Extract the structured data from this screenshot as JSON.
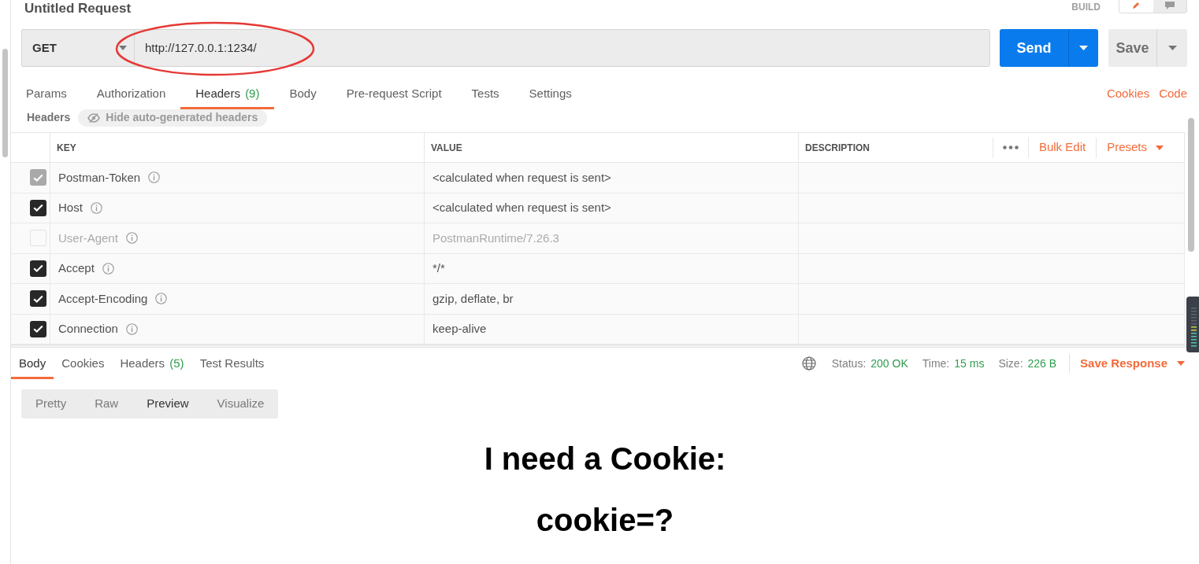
{
  "request": {
    "title": "Untitled Request",
    "mode_label": "BUILD",
    "modes": [
      {
        "kind": "build",
        "selected": true
      },
      {
        "kind": "browse",
        "selected": false
      }
    ]
  },
  "url_bar": {
    "method": "GET",
    "url": "http://127.0.0.1:1234/",
    "circled": true
  },
  "send_button": "Send",
  "save_button": "Save",
  "request_tabs": [
    {
      "label": "Params",
      "selected": false
    },
    {
      "label": "Authorization",
      "selected": false
    },
    {
      "label": "Headers",
      "count": "(9)",
      "selected": true
    },
    {
      "label": "Body",
      "selected": false
    },
    {
      "label": "Pre-request Script",
      "selected": false
    },
    {
      "label": "Tests",
      "selected": false
    },
    {
      "label": "Settings",
      "selected": false
    }
  ],
  "request_links": [
    "Cookies",
    "Code"
  ],
  "headers_bar": {
    "title": "Headers",
    "toggle": "Hide auto-generated headers"
  },
  "headers_table": {
    "columns": [
      "KEY",
      "VALUE",
      "DESCRIPTION"
    ],
    "actions": [
      {
        "label": "Bulk Edit",
        "kind": "button"
      },
      {
        "label": "Presets",
        "kind": "dropdown"
      }
    ],
    "rows": [
      {
        "kind": "locked",
        "key": "Postman-Token",
        "value": "<calculated when request is sent>",
        "checked": true
      },
      {
        "kind": "toggle",
        "key": "Host",
        "value": "<calculated when request is sent>",
        "checked": true
      },
      {
        "kind": "toggle",
        "key": "User-Agent",
        "value": "PostmanRuntime/7.26.3",
        "checked": false
      },
      {
        "kind": "toggle",
        "key": "Accept",
        "value": "*/*",
        "checked": true
      },
      {
        "kind": "toggle",
        "key": "Accept-Encoding",
        "value": "gzip, deflate, br",
        "checked": true
      },
      {
        "kind": "toggle",
        "key": "Connection",
        "value": "keep-alive",
        "checked": true
      }
    ]
  },
  "response": {
    "tabs": [
      {
        "label": "Body",
        "selected": true
      },
      {
        "label": "Cookies",
        "selected": false
      },
      {
        "label": "Headers",
        "count": "(5)",
        "selected": false
      },
      {
        "label": "Test Results",
        "selected": false
      }
    ],
    "stats": [
      {
        "label": "Status:",
        "value": "200 OK"
      },
      {
        "label": "Time:",
        "value": "15 ms"
      },
      {
        "label": "Size:",
        "value": "226 B"
      }
    ],
    "save": "Save Response",
    "views": [
      {
        "label": "Pretty",
        "selected": false
      },
      {
        "label": "Raw",
        "selected": false
      },
      {
        "label": "Preview",
        "selected": true
      },
      {
        "label": "Visualize",
        "selected": false
      }
    ],
    "preview": [
      "I need a Cookie:",
      "cookie=?"
    ]
  }
}
